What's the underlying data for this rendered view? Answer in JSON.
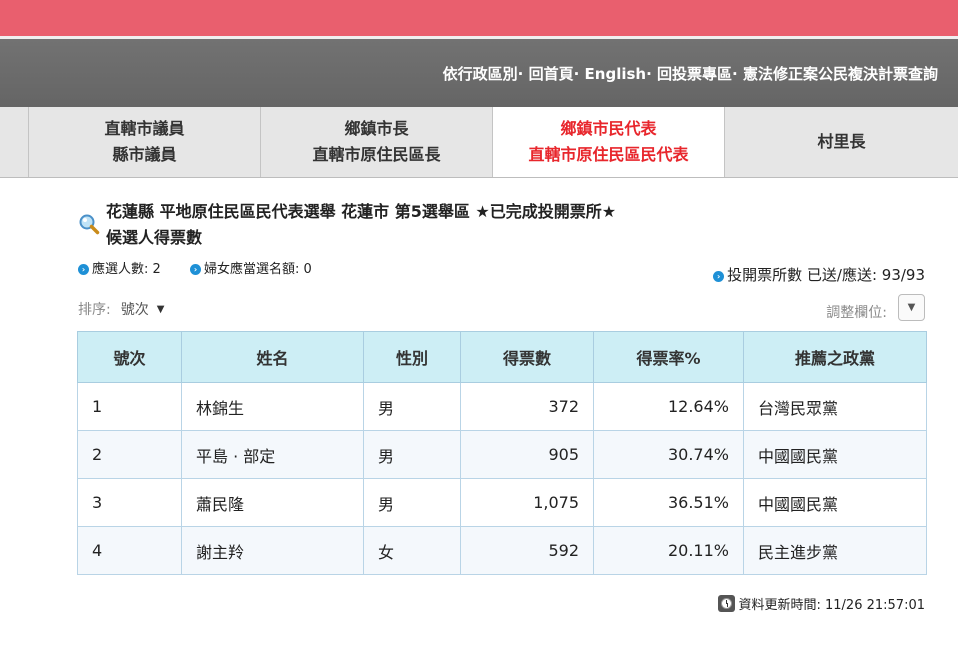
{
  "colors": {
    "top_bar": "#e95f6e",
    "nav_bar": "#6a6a6a",
    "active_tab": "#e8262c",
    "table_header": "#cdeef5",
    "bullet": "#1e90d6"
  },
  "nav": {
    "links": [
      "依行政區別",
      "回首頁",
      "English",
      "回投票專區",
      "憲法修正案公民複決計票查詢"
    ],
    "separator": "·"
  },
  "tabs": [
    {
      "line1": "直轄市議員",
      "line2": "縣市議員",
      "active": false
    },
    {
      "line1": "鄉鎮市長",
      "line2": "直轄市原住民區長",
      "active": false
    },
    {
      "line1": "鄉鎮市民代表",
      "line2": "直轄市原住民區民代表",
      "active": true
    },
    {
      "line1": "村里長",
      "line2": "",
      "active": false
    }
  ],
  "title": {
    "icon": "magnifier-icon",
    "line1": "花蓮縣 平地原住民區民代表選舉 花蓮市 第5選舉區 ★已完成投開票所★",
    "line2": "候選人得票數"
  },
  "info": {
    "bullet_icon": "arrow-circle-icon",
    "elected": "應選人數: 2",
    "women_quota": "婦女應當選名額: 0",
    "progress": "投開票所數 已送/應送: 93/93"
  },
  "sort": {
    "label": "排序:",
    "value": "號次",
    "arrow_icon": "dropdown-arrow-icon"
  },
  "adjust": {
    "label": "調整欄位:",
    "icon": "dropdown-button-icon"
  },
  "table": {
    "headers": [
      "號次",
      "姓名",
      "性別",
      "得票數",
      "得票率%",
      "推薦之政黨"
    ],
    "rows": [
      [
        "1",
        "林錦生",
        "男",
        "372",
        "12.64%",
        "台灣民眾黨"
      ],
      [
        "2",
        "平島 · 部定",
        "男",
        "905",
        "30.74%",
        "中國國民黨"
      ],
      [
        "3",
        "蕭民隆",
        "男",
        "1,075",
        "36.51%",
        "中國國民黨"
      ],
      [
        "4",
        "謝主羚",
        "女",
        "592",
        "20.11%",
        "民主進步黨"
      ]
    ]
  },
  "update": {
    "icon": "clock-icon",
    "text": "資料更新時間: 11/26 21:57:01"
  }
}
